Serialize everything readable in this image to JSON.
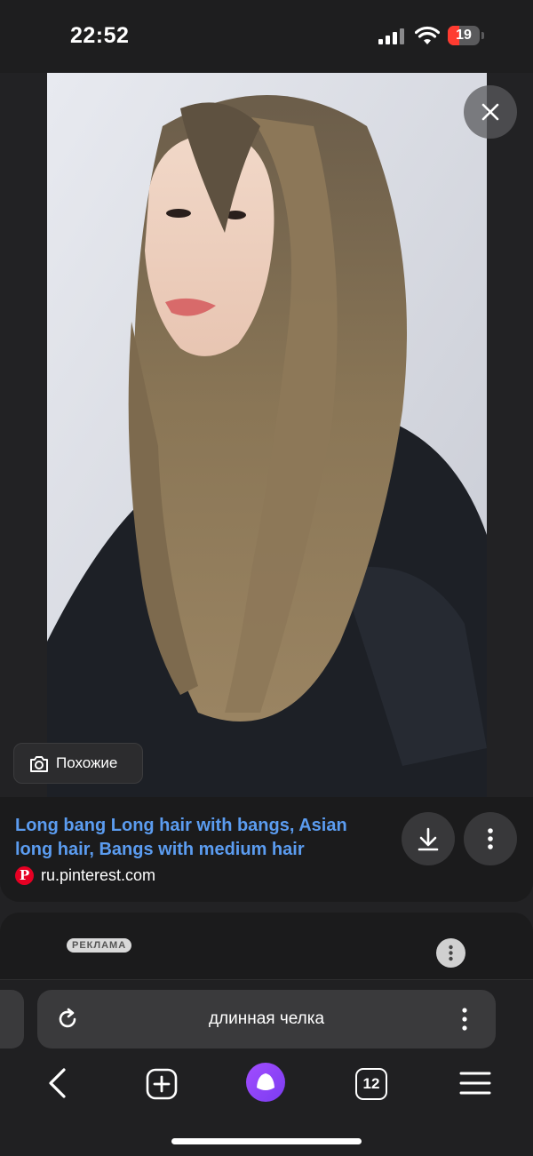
{
  "status_bar": {
    "time": "22:52",
    "battery_level": "19",
    "battery_color": "#ff3b30",
    "signal_icon": "cellular-signal-icon",
    "wifi_icon": "wifi-icon"
  },
  "viewer": {
    "image": "woman-long-hair-bangs-photo",
    "close_icon": "close-icon",
    "similar_button": {
      "label": "Похожие",
      "icon": "camera-lens-icon"
    }
  },
  "result": {
    "title": "Long bang Long hair with bangs, Asian long hair, Bangs with medium hair",
    "source_domain": "ru.pinterest.com",
    "source_icon": "pinterest-icon",
    "download_icon": "download-icon",
    "more_icon": "more-vertical-icon",
    "title_color": "#5b9cf0"
  },
  "ad": {
    "badge": "РЕКЛАМА",
    "more_icon": "more-vertical-icon"
  },
  "browser": {
    "search_query": "длинная челка",
    "tab_count": "12",
    "accent": "#8e44ff"
  }
}
